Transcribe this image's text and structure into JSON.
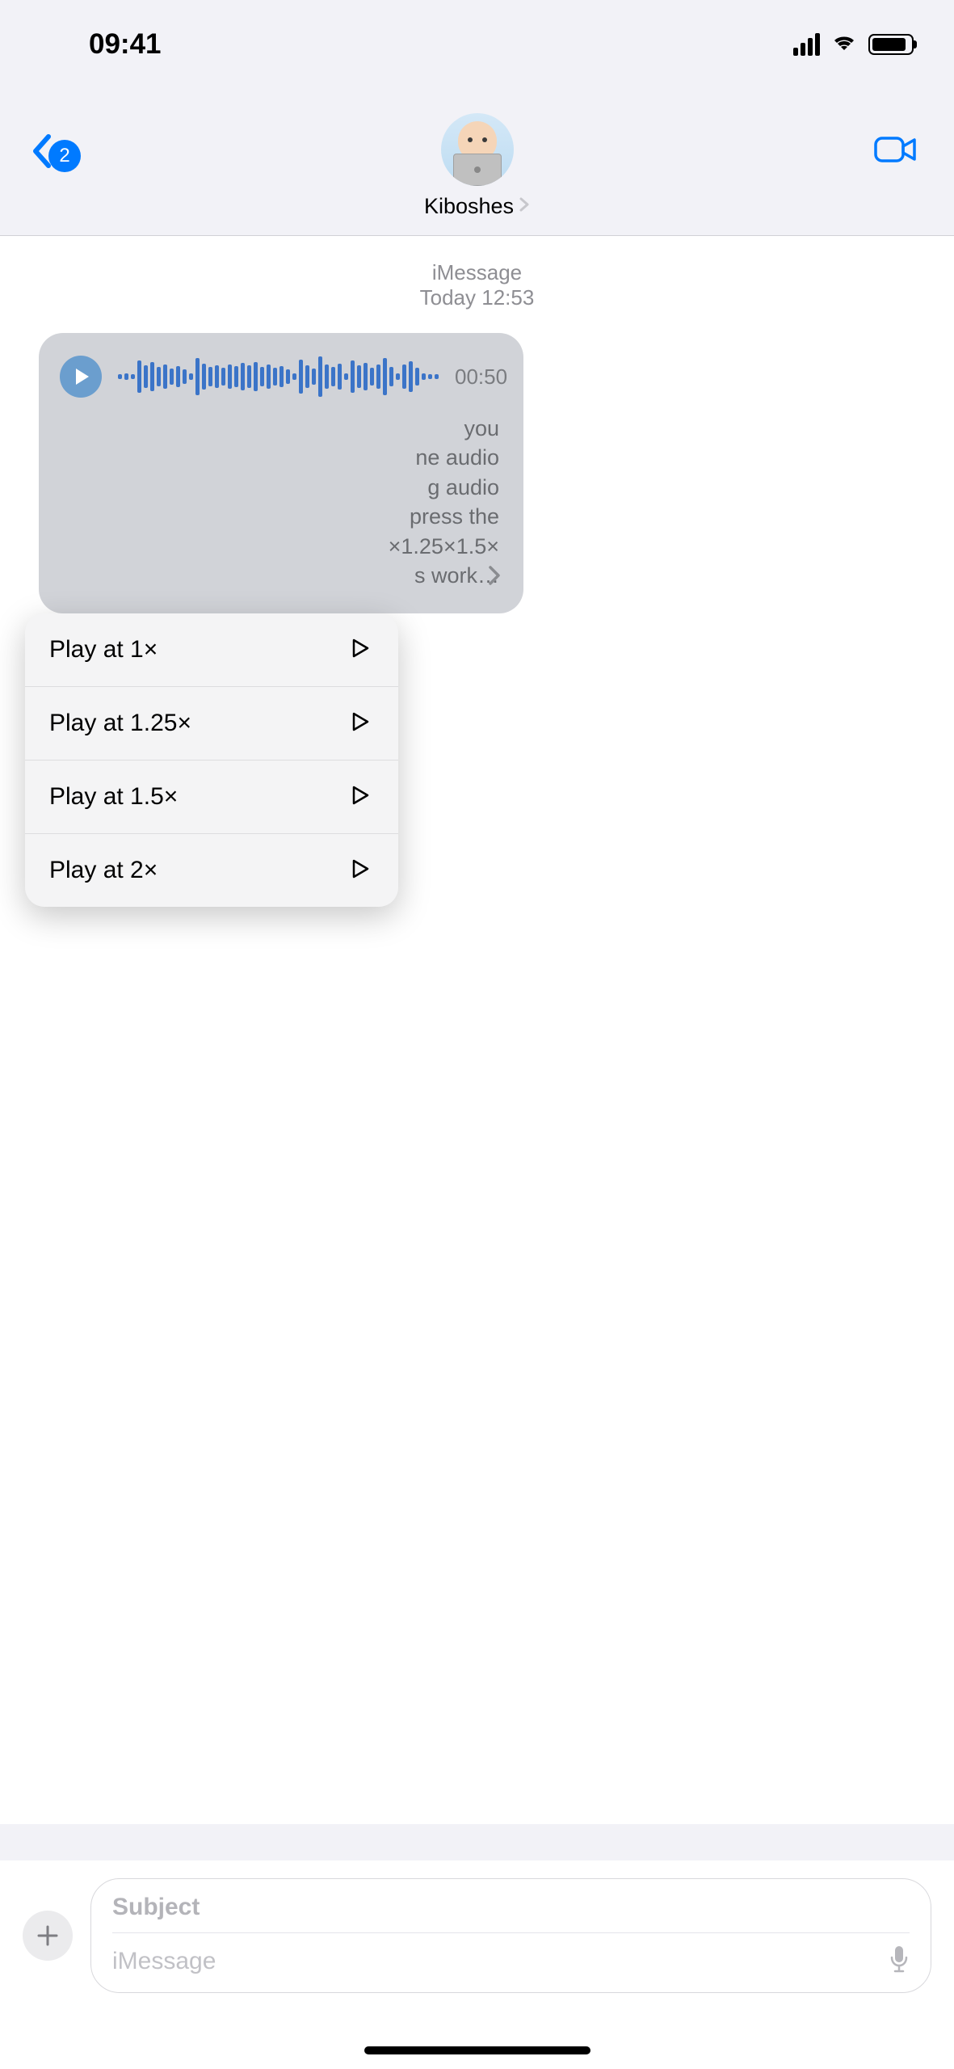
{
  "status_bar": {
    "time": "09:41"
  },
  "header": {
    "badge_count": "2",
    "contact_name": "Kiboshes"
  },
  "conversation": {
    "service_label": "iMessage",
    "date_label": "Today",
    "time_label": "12:53"
  },
  "audio_message": {
    "duration": "00:50",
    "transcript_visible": "you\nne audio\ng audio\npress the\n×1.25×1.5×\ns work…"
  },
  "context_menu": {
    "items": [
      {
        "label": "Play at 1×"
      },
      {
        "label": "Play at 1.25×"
      },
      {
        "label": "Play at 1.5×"
      },
      {
        "label": "Play at 2×"
      }
    ]
  },
  "composer": {
    "subject_placeholder": "Subject",
    "message_placeholder": "iMessage"
  }
}
